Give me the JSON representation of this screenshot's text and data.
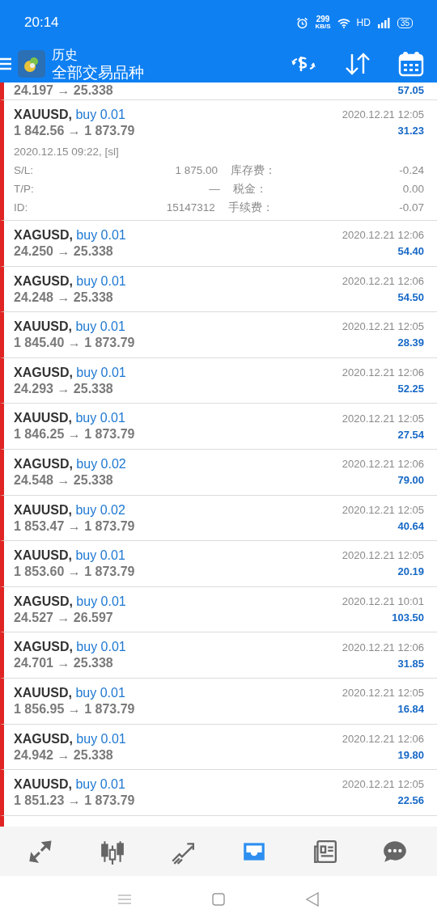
{
  "status_bar": {
    "time": "20:14",
    "speed": "299",
    "speed_unit": "KB/S",
    "network": "HD",
    "battery": "35"
  },
  "header": {
    "title": "历史",
    "subtitle": "全部交易品种"
  },
  "trades": [
    {
      "prices": "24.197 → 25.338",
      "profit": "57.05",
      "expanded": false
    },
    {
      "symbol": "XAUUSD,",
      "side": "buy 0.01",
      "prices": "1 842.56 → 1 873.79",
      "time": "2020.12.21 12:05",
      "profit": "31.23",
      "expanded": true,
      "open_info": "2020.12.15 09:22, [sl]",
      "details": [
        {
          "label": "S/L:",
          "value": "1 875.00",
          "label2": "库存费：",
          "value2": "-0.24"
        },
        {
          "label": "T/P:",
          "value": "—",
          "label2": "税金：",
          "value2": "0.00"
        },
        {
          "label": "ID:",
          "value": "15147312",
          "label2": "手续费：",
          "value2": "-0.07"
        }
      ]
    },
    {
      "symbol": "XAGUSD,",
      "side": "buy 0.01",
      "prices": "24.250 → 25.338",
      "time": "2020.12.21 12:06",
      "profit": "54.40",
      "expanded": false
    },
    {
      "symbol": "XAGUSD,",
      "side": "buy 0.01",
      "prices": "24.248 → 25.338",
      "time": "2020.12.21 12:06",
      "profit": "54.50",
      "expanded": false
    },
    {
      "symbol": "XAUUSD,",
      "side": "buy 0.01",
      "prices": "1 845.40 → 1 873.79",
      "time": "2020.12.21 12:05",
      "profit": "28.39",
      "expanded": false
    },
    {
      "symbol": "XAGUSD,",
      "side": "buy 0.01",
      "prices": "24.293 → 25.338",
      "time": "2020.12.21 12:06",
      "profit": "52.25",
      "expanded": false
    },
    {
      "symbol": "XAUUSD,",
      "side": "buy 0.01",
      "prices": "1 846.25 → 1 873.79",
      "time": "2020.12.21 12:05",
      "profit": "27.54",
      "expanded": false
    },
    {
      "symbol": "XAGUSD,",
      "side": "buy 0.02",
      "prices": "24.548 → 25.338",
      "time": "2020.12.21 12:06",
      "profit": "79.00",
      "expanded": false
    },
    {
      "symbol": "XAUUSD,",
      "side": "buy 0.02",
      "prices": "1 853.47 → 1 873.79",
      "time": "2020.12.21 12:05",
      "profit": "40.64",
      "expanded": false
    },
    {
      "symbol": "XAUUSD,",
      "side": "buy 0.01",
      "prices": "1 853.60 → 1 873.79",
      "time": "2020.12.21 12:05",
      "profit": "20.19",
      "expanded": false
    },
    {
      "symbol": "XAGUSD,",
      "side": "buy 0.01",
      "prices": "24.527 → 26.597",
      "time": "2020.12.21 10:01",
      "profit": "103.50",
      "expanded": false
    },
    {
      "symbol": "XAGUSD,",
      "side": "buy 0.01",
      "prices": "24.701 → 25.338",
      "time": "2020.12.21 12:06",
      "profit": "31.85",
      "expanded": false
    },
    {
      "symbol": "XAUUSD,",
      "side": "buy 0.01",
      "prices": "1 856.95 → 1 873.79",
      "time": "2020.12.21 12:05",
      "profit": "16.84",
      "expanded": false
    },
    {
      "symbol": "XAGUSD,",
      "side": "buy 0.01",
      "prices": "24.942 → 25.338",
      "time": "2020.12.21 12:06",
      "profit": "19.80",
      "expanded": false
    },
    {
      "symbol": "XAUUSD,",
      "side": "buy 0.01",
      "prices": "1 851.23 → 1 873.79",
      "time": "2020.12.21 12:05",
      "profit": "22.56",
      "expanded": false
    },
    {
      "expanded": false
    }
  ],
  "bottom_nav": [
    {
      "kind": "quotes",
      "selected": false
    },
    {
      "kind": "chart",
      "selected": false
    },
    {
      "kind": "trade",
      "selected": false
    },
    {
      "kind": "history",
      "selected": true
    },
    {
      "kind": "news",
      "selected": false
    },
    {
      "kind": "chat",
      "selected": false
    }
  ]
}
